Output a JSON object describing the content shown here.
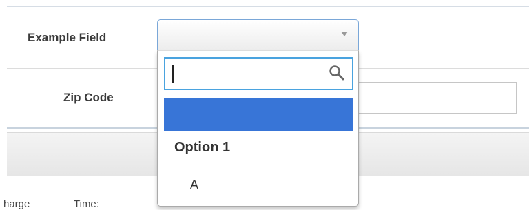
{
  "form": {
    "example_field": {
      "label": "Example Field",
      "selected_value": ""
    },
    "zip_code": {
      "label": "Zip Code",
      "value": ""
    }
  },
  "dropdown": {
    "search_value": "",
    "options": [
      {
        "label": "",
        "highlighted": true
      },
      {
        "group_label": "Option 1",
        "items": [
          "A"
        ]
      }
    ]
  },
  "footer_row": {
    "partial_label_1": "harge",
    "partial_label_2": "Time:"
  },
  "colors": {
    "highlight": "#3875d7",
    "focus_border": "#4aa3df",
    "select_border": "#7aa7d8"
  },
  "icons": {
    "dropdown_arrow": "chevron-down-icon",
    "search": "search-icon"
  }
}
